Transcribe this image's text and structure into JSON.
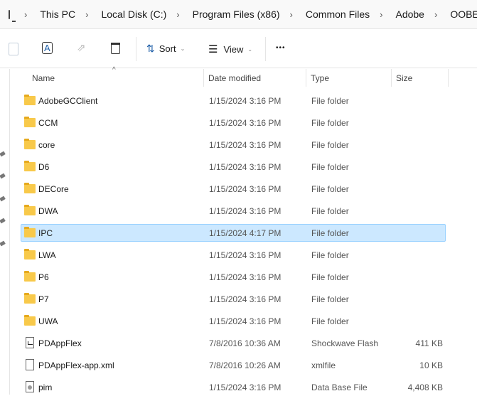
{
  "breadcrumb": [
    "This PC",
    "Local Disk (C:)",
    "Program Files (x86)",
    "Common Files",
    "Adobe",
    "OOBE"
  ],
  "toolbar": {
    "sort_label": "Sort",
    "view_label": "View",
    "more_label": "•••"
  },
  "columns": {
    "name": "Name",
    "date": "Date modified",
    "type": "Type",
    "size": "Size"
  },
  "files": [
    {
      "name": "AdobeGCClient",
      "date": "1/15/2024 3:16 PM",
      "type": "File folder",
      "size": "",
      "icon": "folder"
    },
    {
      "name": "CCM",
      "date": "1/15/2024 3:16 PM",
      "type": "File folder",
      "size": "",
      "icon": "folder"
    },
    {
      "name": "core",
      "date": "1/15/2024 3:16 PM",
      "type": "File folder",
      "size": "",
      "icon": "folder"
    },
    {
      "name": "D6",
      "date": "1/15/2024 3:16 PM",
      "type": "File folder",
      "size": "",
      "icon": "folder"
    },
    {
      "name": "DECore",
      "date": "1/15/2024 3:16 PM",
      "type": "File folder",
      "size": "",
      "icon": "folder"
    },
    {
      "name": "DWA",
      "date": "1/15/2024 3:16 PM",
      "type": "File folder",
      "size": "",
      "icon": "folder"
    },
    {
      "name": "IPC",
      "date": "1/15/2024 4:17 PM",
      "type": "File folder",
      "size": "",
      "icon": "folder",
      "selected": true
    },
    {
      "name": "LWA",
      "date": "1/15/2024 3:16 PM",
      "type": "File folder",
      "size": "",
      "icon": "folder"
    },
    {
      "name": "P6",
      "date": "1/15/2024 3:16 PM",
      "type": "File folder",
      "size": "",
      "icon": "folder"
    },
    {
      "name": "P7",
      "date": "1/15/2024 3:16 PM",
      "type": "File folder",
      "size": "",
      "icon": "folder"
    },
    {
      "name": "UWA",
      "date": "1/15/2024 3:16 PM",
      "type": "File folder",
      "size": "",
      "icon": "folder"
    },
    {
      "name": "PDAppFlex",
      "date": "7/8/2016 10:36 AM",
      "type": "Shockwave Flash",
      "size": "411 KB",
      "icon": "swf"
    },
    {
      "name": "PDAppFlex-app.xml",
      "date": "7/8/2016 10:26 AM",
      "type": "xmlfile",
      "size": "10 KB",
      "icon": "file"
    },
    {
      "name": "pim",
      "date": "1/15/2024 3:16 PM",
      "type": "Data Base File",
      "size": "4,408 KB",
      "icon": "db"
    }
  ]
}
